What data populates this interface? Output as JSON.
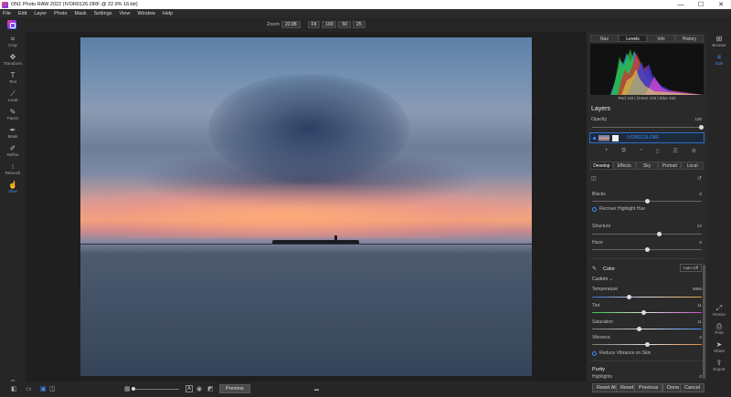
{
  "window": {
    "title": "ON1 Photo RAW 2022 (IVOR0126.ORF @ 22.9% 16-bit)",
    "minimize": "—",
    "maximize": "☐",
    "close": "✕"
  },
  "menu": [
    "File",
    "Edit",
    "Layer",
    "Photo",
    "Mask",
    "Settings",
    "View",
    "Window",
    "Help"
  ],
  "toolbar": {
    "zoom_label": "Zoom",
    "zoom_value": "22.88",
    "fit_buttons": [
      "Fit",
      "100",
      "50",
      "25"
    ]
  },
  "left_tools": [
    {
      "icon": "crop-icon",
      "glyph": "⌗",
      "label": "Crop",
      "active": false
    },
    {
      "icon": "transform-icon",
      "glyph": "✥",
      "label": "Transform",
      "active": false
    },
    {
      "icon": "text-icon",
      "glyph": "T",
      "label": "Text",
      "active": false
    },
    {
      "icon": "local-icon",
      "glyph": "⟋",
      "label": "Local",
      "active": false
    },
    {
      "icon": "faces-icon",
      "glyph": "✎",
      "label": "Faces",
      "active": false
    },
    {
      "icon": "mask-icon",
      "glyph": "✒",
      "label": "Mask",
      "active": false
    },
    {
      "icon": "refine-icon",
      "glyph": "✐",
      "label": "Refine",
      "active": false
    },
    {
      "icon": "retouch-icon",
      "glyph": "⁝",
      "label": "Retouch",
      "active": false
    },
    {
      "icon": "view-icon",
      "glyph": "☝",
      "label": "View",
      "active": true
    }
  ],
  "right_side": [
    {
      "icon": "browse-icon",
      "glyph": "⊞",
      "label": "Browse",
      "active": false
    },
    {
      "icon": "edit-icon",
      "glyph": "≡",
      "label": "Edit",
      "active": true
    },
    {
      "icon": "resize-icon",
      "glyph": "⤢",
      "label": "Resize",
      "active": false
    },
    {
      "icon": "print-icon",
      "glyph": "⎙",
      "label": "Print",
      "active": false
    },
    {
      "icon": "share-icon",
      "glyph": "➤",
      "label": "Share",
      "active": false
    },
    {
      "icon": "export-icon",
      "glyph": "⇪",
      "label": "Export",
      "active": false
    }
  ],
  "panel_tabs": [
    "Nav",
    "Levels",
    "Info",
    "History"
  ],
  "panel_tab_selected": "Levels",
  "histogram_readout": "Red 115 | Green 125 | Blue 152",
  "layers": {
    "title": "Layers",
    "opacity_label": "Opacity",
    "opacity_value": "100",
    "opacity_fraction": 1.0,
    "layer_name": "IVOR0126.ORF"
  },
  "develop_tabs": [
    "Develop",
    "Effects",
    "Sky",
    "Portrait",
    "Local"
  ],
  "develop_tab_selected": "Develop",
  "tone": {
    "blacks_label": "Blacks",
    "blacks_value": "0",
    "recover_label": "Recover Highlight Hue",
    "structure_label": "Structure",
    "structure_value": "22",
    "haze_label": "Haze",
    "haze_value": "0"
  },
  "color": {
    "title": "Color",
    "auto_label": "Auto Off",
    "preset": "Custom",
    "temperature_label": "Temperature",
    "temperature_value": "5886",
    "tint_label": "Tint",
    "tint_value": "11",
    "saturation_label": "Saturation",
    "saturation_value": "11",
    "vibrance_label": "Vibrance",
    "vibrance_value": "0",
    "reduce_vibrance_label": "Reduce Vibrance on Skin"
  },
  "purity": {
    "title": "Purity",
    "highlights_label": "Highlights",
    "highlights_value": "0"
  },
  "footer_buttons": [
    "Reset All",
    "Reset",
    "Previous",
    "Done",
    "Cancel"
  ],
  "bottom": {
    "preview_label": "Preview",
    "a_label": "A"
  }
}
